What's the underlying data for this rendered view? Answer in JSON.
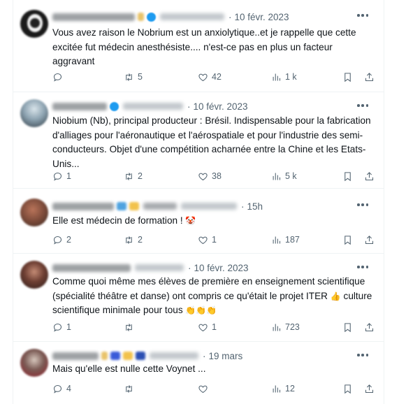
{
  "tweets": [
    {
      "date": "10 févr. 2023",
      "text": "Vous avez raison le Nobrium est un anxiolytique..et je rappelle que cette excitée fut médecin anesthésiste.... n'est-ce pas en plus un facteur aggravant",
      "replies": "",
      "retweets": "5",
      "likes": "42",
      "views": "1 k"
    },
    {
      "date": "10 févr. 2023",
      "text": "Niobium (Nb), principal producteur : Brésil. Indispensable pour la fabrication d'alliages pour l'aéronautique et l'aérospatiale et pour l'industrie des semi-conducteurs. Objet d'une compétition acharnée entre la Chine et les Etats-Unis...",
      "replies": "1",
      "retweets": "2",
      "likes": "38",
      "views": "5 k"
    },
    {
      "date": "15h",
      "text": "Elle est médecin de formation !",
      "emoji": "🤡",
      "replies": "2",
      "retweets": "2",
      "likes": "1",
      "views": "187"
    },
    {
      "date": "10 févr. 2023",
      "text": "Comme quoi même mes élèves de première en enseignement scientifique (spécialité théâtre et danse) ont compris ce qu'était le projet ITER",
      "emoji": "👍",
      "text2": "culture scientifique minimale pour tous",
      "emoji2": "👏👏👏",
      "replies": "1",
      "retweets": "",
      "likes": "1",
      "views": "723"
    },
    {
      "date": "19 mars",
      "text": "Mais qu'elle est nulle cette Voynet ...",
      "replies": "4",
      "retweets": "",
      "likes": "",
      "views": "12"
    }
  ],
  "icons": {
    "reply": "reply-icon",
    "retweet": "retweet-icon",
    "like": "heart-icon",
    "views": "views-icon",
    "bookmark": "bookmark-icon",
    "share": "share-icon",
    "more": "more-icon"
  },
  "colors": {
    "secondary_text": "#536471",
    "verified": "#1d9bf0",
    "divider": "#eff3f4"
  }
}
